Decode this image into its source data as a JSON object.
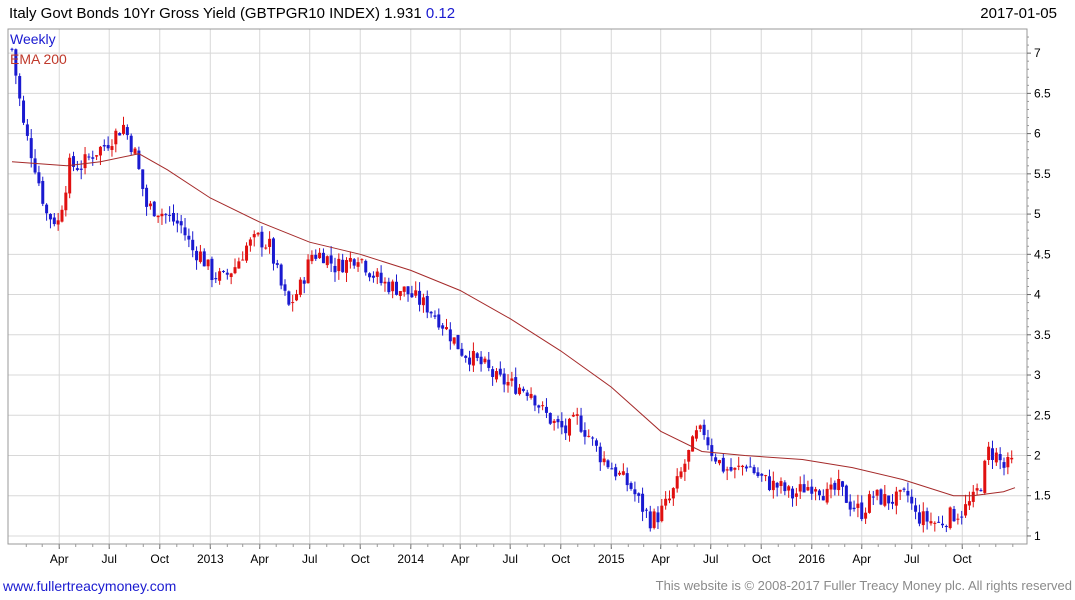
{
  "header": {
    "title": "Italy Govt Bonds 10Yr Gross Yield (GBTPGR10 INDEX)",
    "last": "1.931",
    "change": "0.12",
    "date": "2017-01-05"
  },
  "legend": {
    "frequency": "Weekly",
    "overlay": "EMA 200"
  },
  "footer": {
    "site": "www.fullertreacymoney.com",
    "copyright": "This website is © 2008-2017 Fuller Treacy Money plc. All rights reserved"
  },
  "colors": {
    "up": "#1a1ad0",
    "down": "#e01010",
    "ema": "#a52a2a",
    "grid": "#d8d8d8"
  },
  "chart_data": {
    "type": "candlestick",
    "title": "Italy Govt Bonds 10Yr Gross Yield (GBTPGR10 INDEX)",
    "frequency": "Weekly",
    "ylim": [
      0.9,
      7.3
    ],
    "y_ticks": [
      "1",
      "1.5",
      "2",
      "2.5",
      "3",
      "3.5",
      "4",
      "4.5",
      "5",
      "5.5",
      "6",
      "6.5",
      "7"
    ],
    "x_ticks": [
      {
        "label": "Apr",
        "date": "2012-04-01"
      },
      {
        "label": "Jul",
        "date": "2012-07-01"
      },
      {
        "label": "Oct",
        "date": "2012-10-01"
      },
      {
        "label": "2013",
        "date": "2013-01-01"
      },
      {
        "label": "Apr",
        "date": "2013-04-01"
      },
      {
        "label": "Jul",
        "date": "2013-07-01"
      },
      {
        "label": "Oct",
        "date": "2013-10-01"
      },
      {
        "label": "2014",
        "date": "2014-01-01"
      },
      {
        "label": "Apr",
        "date": "2014-04-01"
      },
      {
        "label": "Jul",
        "date": "2014-07-01"
      },
      {
        "label": "Oct",
        "date": "2014-10-01"
      },
      {
        "label": "2015",
        "date": "2015-01-01"
      },
      {
        "label": "Apr",
        "date": "2015-04-01"
      },
      {
        "label": "Jul",
        "date": "2015-07-01"
      },
      {
        "label": "Oct",
        "date": "2015-10-01"
      },
      {
        "label": "2016",
        "date": "2016-01-01"
      },
      {
        "label": "Apr",
        "date": "2016-04-01"
      },
      {
        "label": "Jul",
        "date": "2016-07-01"
      },
      {
        "label": "Oct",
        "date": "2016-10-01"
      }
    ],
    "x_range": [
      "2012-01-06",
      "2017-01-05"
    ],
    "series": [
      {
        "name": "Weekly",
        "kind": "close",
        "points": [
          [
            "2012-01-06",
            7.05
          ],
          [
            "2012-01-27",
            6.1
          ],
          [
            "2012-02-17",
            5.6
          ],
          [
            "2012-03-09",
            5.0
          ],
          [
            "2012-03-30",
            4.9
          ],
          [
            "2012-04-20",
            5.6
          ],
          [
            "2012-05-11",
            5.6
          ],
          [
            "2012-06-01",
            5.75
          ],
          [
            "2012-06-22",
            5.85
          ],
          [
            "2012-07-13",
            6.0
          ],
          [
            "2012-07-27",
            6.1
          ],
          [
            "2012-08-17",
            5.75
          ],
          [
            "2012-09-07",
            5.1
          ],
          [
            "2012-09-28",
            5.05
          ],
          [
            "2012-10-19",
            4.95
          ],
          [
            "2012-11-09",
            4.85
          ],
          [
            "2012-11-30",
            4.55
          ],
          [
            "2012-12-14",
            4.5
          ],
          [
            "2013-01-04",
            4.25
          ],
          [
            "2013-01-25",
            4.2
          ],
          [
            "2013-02-15",
            4.35
          ],
          [
            "2013-03-08",
            4.6
          ],
          [
            "2013-03-29",
            4.7
          ],
          [
            "2013-04-19",
            4.6
          ],
          [
            "2013-05-10",
            4.1
          ],
          [
            "2013-05-24",
            3.85
          ],
          [
            "2013-06-14",
            4.1
          ],
          [
            "2013-07-05",
            4.5
          ],
          [
            "2013-07-26",
            4.5
          ],
          [
            "2013-08-16",
            4.35
          ],
          [
            "2013-09-06",
            4.4
          ],
          [
            "2013-09-27",
            4.5
          ],
          [
            "2013-10-18",
            4.3
          ],
          [
            "2013-11-08",
            4.15
          ],
          [
            "2013-11-29",
            4.1
          ],
          [
            "2013-12-20",
            4.05
          ],
          [
            "2014-01-10",
            3.95
          ],
          [
            "2014-01-31",
            3.85
          ],
          [
            "2014-02-21",
            3.7
          ],
          [
            "2014-03-14",
            3.5
          ],
          [
            "2014-04-04",
            3.3
          ],
          [
            "2014-04-25",
            3.2
          ],
          [
            "2014-05-16",
            3.1
          ],
          [
            "2014-06-06",
            2.95
          ],
          [
            "2014-06-27",
            2.9
          ],
          [
            "2014-07-18",
            2.85
          ],
          [
            "2014-08-08",
            2.8
          ],
          [
            "2014-08-29",
            2.55
          ],
          [
            "2014-09-19",
            2.4
          ],
          [
            "2014-10-10",
            2.3
          ],
          [
            "2014-10-31",
            2.45
          ],
          [
            "2014-11-21",
            2.25
          ],
          [
            "2014-12-12",
            2.0
          ],
          [
            "2014-12-26",
            1.9
          ],
          [
            "2015-01-16",
            1.75
          ],
          [
            "2015-02-06",
            1.6
          ],
          [
            "2015-02-27",
            1.35
          ],
          [
            "2015-03-13",
            1.2
          ],
          [
            "2015-03-27",
            1.25
          ],
          [
            "2015-04-17",
            1.45
          ],
          [
            "2015-05-01",
            1.65
          ],
          [
            "2015-05-15",
            1.9
          ],
          [
            "2015-06-05",
            2.25
          ],
          [
            "2015-06-19",
            2.3
          ],
          [
            "2015-07-03",
            2.05
          ],
          [
            "2015-07-24",
            1.85
          ],
          [
            "2015-08-14",
            1.8
          ],
          [
            "2015-09-04",
            1.9
          ],
          [
            "2015-09-25",
            1.75
          ],
          [
            "2015-10-16",
            1.65
          ],
          [
            "2015-11-06",
            1.6
          ],
          [
            "2015-11-27",
            1.5
          ],
          [
            "2015-12-18",
            1.6
          ],
          [
            "2016-01-08",
            1.65
          ],
          [
            "2016-01-29",
            1.5
          ],
          [
            "2016-02-19",
            1.6
          ],
          [
            "2016-03-11",
            1.4
          ],
          [
            "2016-04-01",
            1.3
          ],
          [
            "2016-04-22",
            1.5
          ],
          [
            "2016-05-13",
            1.45
          ],
          [
            "2016-06-03",
            1.45
          ],
          [
            "2016-06-24",
            1.5
          ],
          [
            "2016-07-08",
            1.25
          ],
          [
            "2016-07-29",
            1.2
          ],
          [
            "2016-08-19",
            1.15
          ],
          [
            "2016-09-09",
            1.25
          ],
          [
            "2016-09-30",
            1.3
          ],
          [
            "2016-10-21",
            1.45
          ],
          [
            "2016-11-04",
            1.65
          ],
          [
            "2016-11-18",
            2.05
          ],
          [
            "2016-12-02",
            2.0
          ],
          [
            "2016-12-16",
            1.85
          ],
          [
            "2017-01-05",
            1.93
          ]
        ]
      },
      {
        "name": "EMA 200",
        "kind": "ema",
        "points": [
          [
            "2012-01-06",
            5.65
          ],
          [
            "2012-04-15",
            5.6
          ],
          [
            "2012-06-15",
            5.65
          ],
          [
            "2012-08-24",
            5.75
          ],
          [
            "2012-10-15",
            5.55
          ],
          [
            "2013-01-01",
            5.2
          ],
          [
            "2013-04-01",
            4.9
          ],
          [
            "2013-07-01",
            4.65
          ],
          [
            "2013-10-01",
            4.5
          ],
          [
            "2014-01-01",
            4.3
          ],
          [
            "2014-04-01",
            4.05
          ],
          [
            "2014-07-01",
            3.7
          ],
          [
            "2014-10-01",
            3.3
          ],
          [
            "2015-01-01",
            2.85
          ],
          [
            "2015-04-01",
            2.3
          ],
          [
            "2015-06-15",
            2.05
          ],
          [
            "2015-09-01",
            2.0
          ],
          [
            "2015-12-15",
            1.95
          ],
          [
            "2016-03-15",
            1.85
          ],
          [
            "2016-06-15",
            1.7
          ],
          [
            "2016-09-15",
            1.5
          ],
          [
            "2016-10-20",
            1.5
          ],
          [
            "2016-12-15",
            1.55
          ],
          [
            "2017-01-05",
            1.6
          ]
        ]
      }
    ]
  }
}
